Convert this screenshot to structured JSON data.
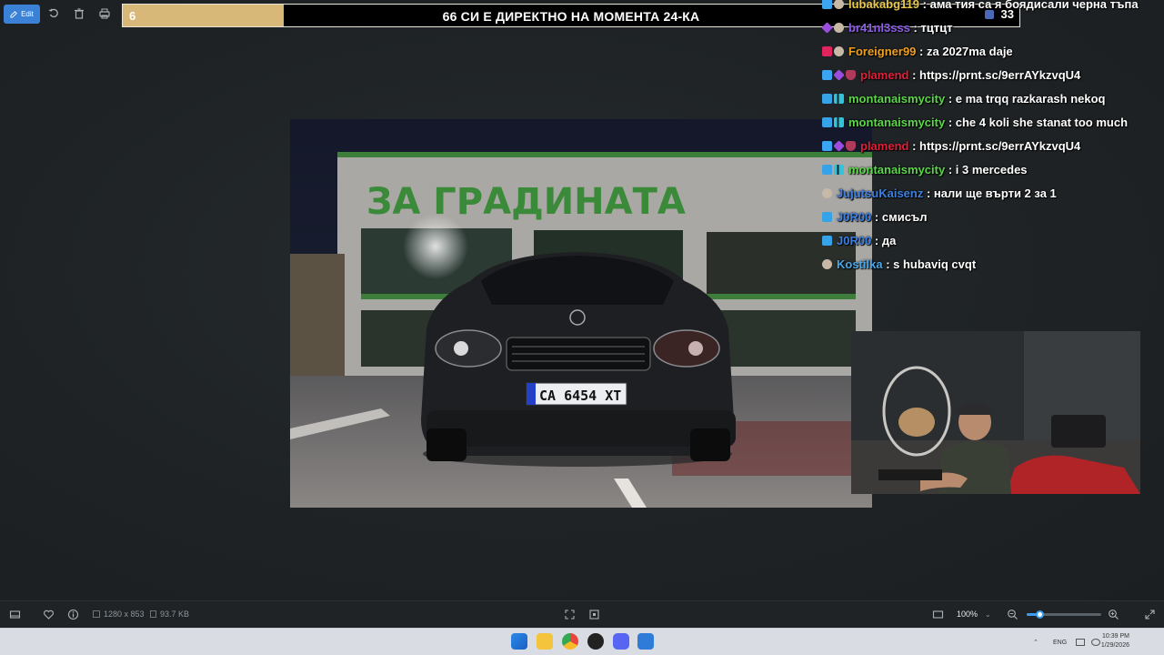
{
  "toolbar": {
    "edit_label": "Edit",
    "icons": [
      "edit-icon",
      "rotate-icon",
      "delete-icon",
      "print-icon"
    ]
  },
  "banner": {
    "count": "6",
    "title": "66 СИ Е ДИРЕКТНО НА МОМЕНТА 24-КА",
    "progress": 0.18,
    "right_number": "33"
  },
  "photo": {
    "store_sign": "ЗА ГРАДИНАТА",
    "plate": "CA 6454 XT",
    "accent_green": "#3a8a3a"
  },
  "chat": {
    "lines": [
      {
        "badges": [
          "b-bolt",
          "b-face"
        ],
        "user": "lubakabg119",
        "color": "#e8c84a",
        "msg": "ама тия са я боядисали черна тъпа"
      },
      {
        "badges": [
          "b-gem",
          "b-face"
        ],
        "user": "br41nl3sss",
        "color": "#8e5de8",
        "msg": "тцтцт"
      },
      {
        "badges": [
          "b-red",
          "b-face"
        ],
        "user": "Foreigner99",
        "color": "#f0a020",
        "msg": "za 2027ma daje"
      },
      {
        "badges": [
          "b-bolt",
          "b-gem",
          "b-shield"
        ],
        "user": "plamend",
        "color": "#e0203a",
        "msg": "https://prnt.sc/9errAYkzvqU4"
      },
      {
        "badges": [
          "b-cube",
          "b-bars"
        ],
        "user": "montanaismycity",
        "color": "#5cd64a",
        "msg": "e ma trqq razkarash nekoq"
      },
      {
        "badges": [
          "b-cube",
          "b-bars"
        ],
        "user": "montanaismycity",
        "color": "#5cd64a",
        "msg": "che 4 koli she stanat too much"
      },
      {
        "badges": [
          "b-bolt",
          "b-gem",
          "b-shield"
        ],
        "user": "plamend",
        "color": "#e0203a",
        "msg": "https://prnt.sc/9errAYkzvqU4"
      },
      {
        "badges": [
          "b-cube",
          "b-bars"
        ],
        "user": "montanaismycity",
        "color": "#5cd64a",
        "msg": "i 3 mercedes"
      },
      {
        "badges": [
          "b-face"
        ],
        "user": "JujutsuKaisenz",
        "color": "#3e7fe0",
        "msg": "нали ще върти 2 за 1"
      },
      {
        "badges": [
          "b-cube"
        ],
        "user": "J0R00",
        "color": "#3e7fe0",
        "msg": "смисъл"
      },
      {
        "badges": [
          "b-cube"
        ],
        "user": "J0R00",
        "color": "#3e7fe0",
        "msg": "да"
      },
      {
        "badges": [
          "b-face"
        ],
        "user": "Kostilka",
        "color": "#4aa8e8",
        "msg": "s hubaviq cvqt"
      }
    ]
  },
  "statusbar": {
    "dimensions": "1280 x 853",
    "filesize": "93.7 KB",
    "zoom": "100%",
    "zoom_level": 0.18
  },
  "taskbar": {
    "lang": "ENG",
    "time": "10:39 PM",
    "date": "1/29/2026"
  }
}
